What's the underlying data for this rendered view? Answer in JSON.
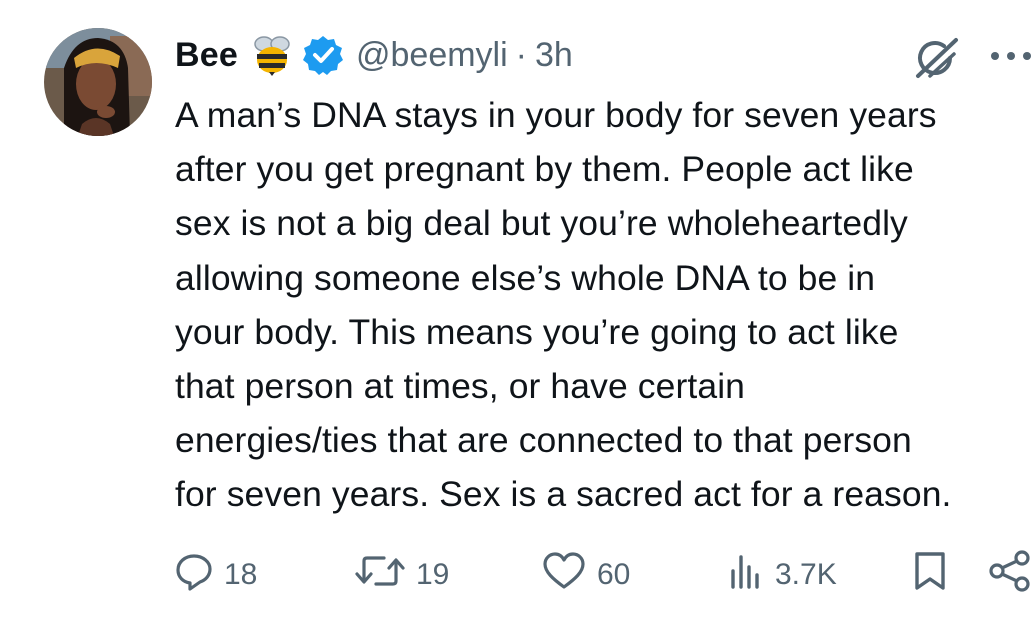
{
  "tweet": {
    "display_name": "Bee",
    "handle": "@beemyli",
    "separator": "·",
    "time": "3h",
    "text_lines": [
      "A man’s DNA stays in your body for seven years",
      "after you get pregnant by them. People act like",
      "sex is not a big deal but you’re wholeheartedly",
      "allowing someone else’s whole DNA to be in",
      "your body. This means you’re going to act like",
      "that person at times, or have certain",
      "energies/ties that are connected to that person",
      "for seven years. Sex is a sacred act for a reason."
    ]
  },
  "metrics": {
    "replies": "18",
    "reposts": "19",
    "likes": "60",
    "views": "3.7K"
  },
  "icons": {
    "name_emoji": "bee-icon",
    "badge": "verified-badge-icon",
    "grok": "grok-icon",
    "more": "more-icon",
    "reply": "reply-icon",
    "repost": "repost-icon",
    "like": "like-icon",
    "views": "views-icon",
    "bookmark": "bookmark-icon",
    "share": "share-icon"
  },
  "colors": {
    "text": "#0f1419",
    "secondary": "#536471",
    "verified": "#1d9bf0",
    "background": "#ffffff"
  }
}
